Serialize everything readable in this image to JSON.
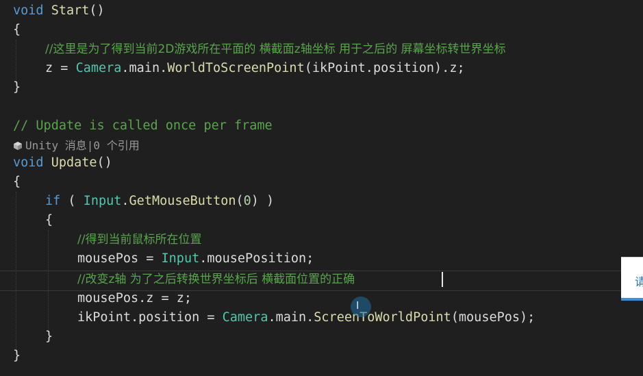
{
  "code": {
    "l01_void": "void",
    "l01_start": "Start",
    "l01_paren": "()",
    "brace_open_1": "{",
    "l03_comment": "//这里是为了得到当前2D游戏所在平面的 横截面z轴坐标 用于之后的 屏幕坐标转世界坐标",
    "l04_z": "z = ",
    "l04_camera": "Camera",
    "l04_main": ".main.",
    "l04_fn": "WorldToScreenPoint",
    "l04_rest": "(ikPoint.position).z;",
    "brace_close_1": "}",
    "l06_comment": "// Update is called once per frame",
    "l08_void": "void",
    "l08_update": "Update",
    "l08_paren": "()",
    "brace_open_2": "{",
    "l10_if": "if",
    "l10_open": " ( ",
    "l10_input": "Input",
    "l10_dot": ".",
    "l10_fn": "GetMouseButton",
    "l10_arg_open": "(",
    "l10_arg": "0",
    "l10_arg_close": ") )",
    "brace_open_3": "{",
    "l12_comment": "//得到当前鼠标所在位置",
    "l13_lhs": "mousePos = ",
    "l13_input": "Input",
    "l13_rest": ".mousePosition;",
    "l14_comment": "//改变z轴 为了之后转换世界坐标后 横截面位置的正确",
    "l15_code": "mousePos.z = z;",
    "l16_lhs": "ikPoint.position = ",
    "l16_camera": "Camera",
    "l16_main": ".main.",
    "l16_fn": "ScreenToWorldPoint",
    "l16_rest": "(mousePos);",
    "brace_close_3": "}",
    "brace_close_2": "}"
  },
  "codelens": {
    "text": "Unity 消息|0 个引用",
    "icon": "unity-cube-icon"
  },
  "popup": {
    "text": "请"
  },
  "colors": {
    "background": "#1f1f1f",
    "keyword": "#569cd6",
    "type": "#4ec9b0",
    "method": "#dcdcaa",
    "comment": "#57a64a",
    "number": "#b5cea8"
  }
}
